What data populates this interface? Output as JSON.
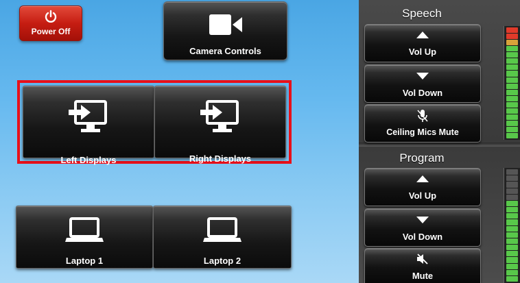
{
  "power": {
    "label": "Power Off"
  },
  "camera": {
    "label": "Camera Controls"
  },
  "displays": [
    {
      "label": "Left Displays"
    },
    {
      "label": "Right Displays"
    }
  ],
  "laptops": [
    {
      "label": "Laptop 1"
    },
    {
      "label": "Laptop 2"
    }
  ],
  "speech": {
    "title": "Speech",
    "vol_up": "Vol Up",
    "vol_down": "Vol Down",
    "mute": "Ceiling Mics Mute"
  },
  "program": {
    "title": "Program",
    "vol_up": "Vol Up",
    "vol_down": "Vol Down",
    "mute": "Mute"
  },
  "colors": {
    "background": "#66b9ef",
    "power": "#c61d12",
    "highlight_border": "#e8101a",
    "meter_green": "#58c84a",
    "meter_red": "#e03a2a"
  },
  "icons": {
    "power": "power-icon",
    "camera": "video-camera-icon",
    "display": "display-input-icon",
    "laptop": "laptop-icon",
    "mic_mute": "microphone-mute-icon",
    "speaker_mute": "speaker-mute-icon"
  }
}
